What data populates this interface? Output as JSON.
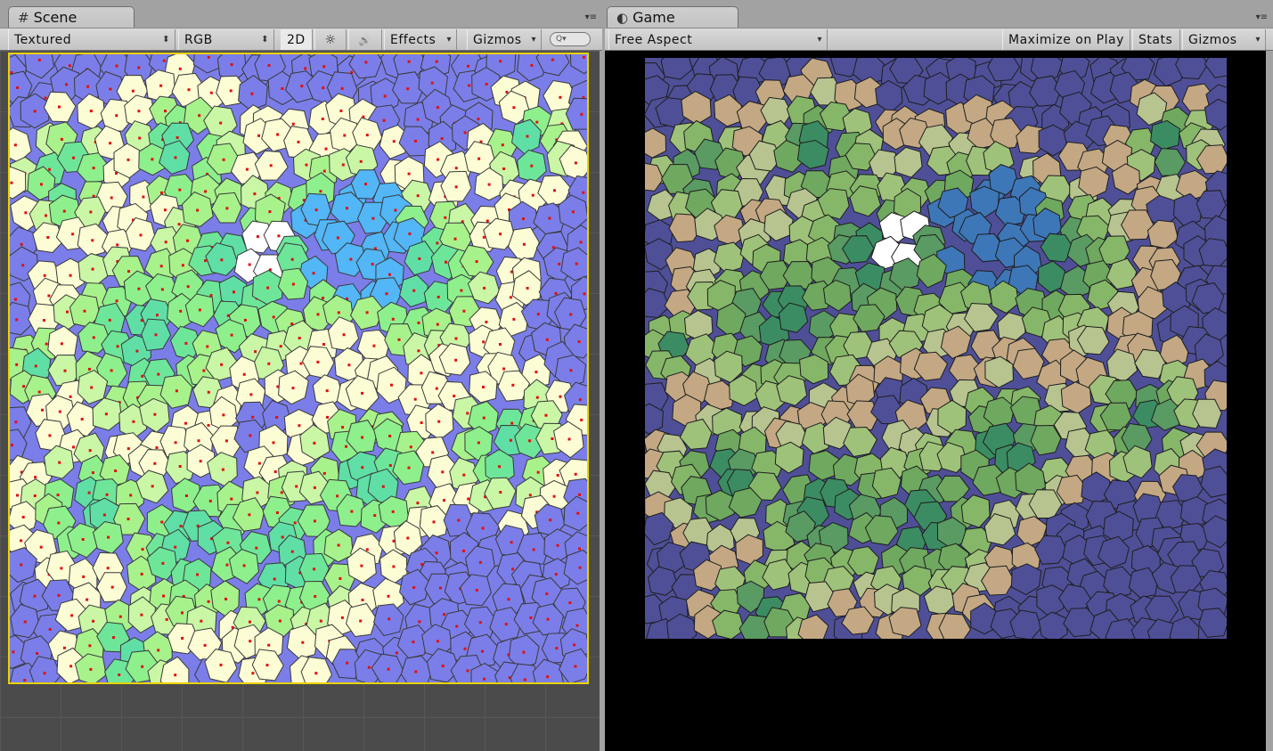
{
  "scene": {
    "tab_title": "Scene",
    "tab_icon": "#",
    "panel_menu": "▾≡",
    "toolbar": {
      "shading_mode": "Textured",
      "render_mode": "RGB",
      "mode_2d": "2D",
      "lighting_icon": "☼",
      "audio_icon": "🔊",
      "effects": "Effects",
      "gizmos": "Gizmos",
      "search_placeholder": "Q▾"
    }
  },
  "game": {
    "tab_title": "Game",
    "tab_icon": "◐",
    "panel_menu": "▾≡",
    "toolbar": {
      "aspect": "Free Aspect",
      "maximize_on_play": "Maximize on Play",
      "stats": "Stats",
      "gizmos": "Gizmos"
    }
  },
  "colors": {
    "editor_bg": "#a2a2a2",
    "scene_ocean": "#7b7ee8",
    "scene_land": "#fdfdd5",
    "game_ocean": "#4f4f98",
    "game_land": "#c3a883",
    "site_marker": "#e01010",
    "selection_outline": "#e8d200"
  }
}
